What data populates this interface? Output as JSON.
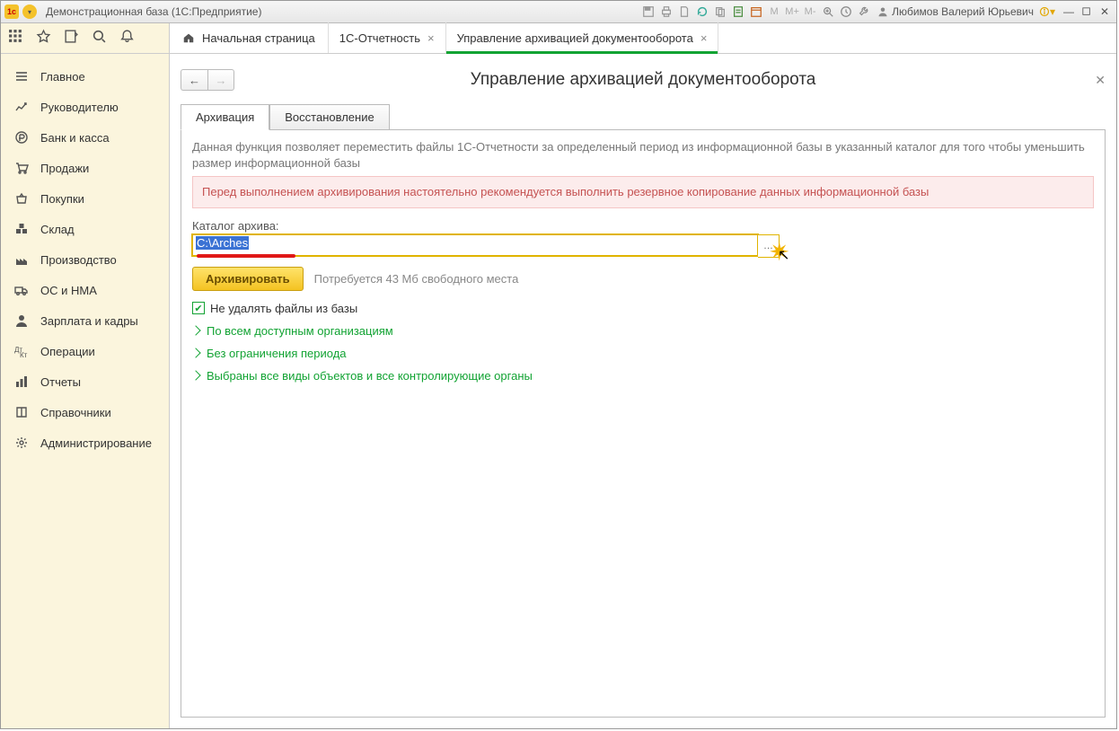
{
  "window_title": "Демонстрационная база  (1С:Предприятие)",
  "user_name": "Любимов Валерий Юрьевич",
  "m_buttons": [
    "M",
    "M+",
    "M-"
  ],
  "nav_items": [
    {
      "icon": "menu",
      "label": "Главное"
    },
    {
      "icon": "chart",
      "label": "Руководителю"
    },
    {
      "icon": "ruble",
      "label": "Банк и касса"
    },
    {
      "icon": "cart",
      "label": "Продажи"
    },
    {
      "icon": "basket",
      "label": "Покупки"
    },
    {
      "icon": "boxes",
      "label": "Склад"
    },
    {
      "icon": "factory",
      "label": "Производство"
    },
    {
      "icon": "truck",
      "label": "ОС и НМА"
    },
    {
      "icon": "person",
      "label": "Зарплата и кадры"
    },
    {
      "icon": "ops",
      "label": "Операции"
    },
    {
      "icon": "bars",
      "label": "Отчеты"
    },
    {
      "icon": "book",
      "label": "Справочники"
    },
    {
      "icon": "gear",
      "label": "Администрирование"
    }
  ],
  "tabs": {
    "home": "Начальная страница",
    "t1": "1С-Отчетность",
    "t2": "Управление архивацией документооборота"
  },
  "page_title": "Управление архивацией документооборота",
  "inner_tabs": {
    "t1": "Архивация",
    "t2": "Восстановление"
  },
  "desc": "Данная функция позволяет переместить файлы 1С-Отчетности за определенный период из информационной базы в указанный каталог для того чтобы уменьшить размер информационной базы",
  "warning": "Перед выполнением архивирования настоятельно рекомендуется выполнить резервное копирование данных информационной базы",
  "catalog_label": "Каталог архива:",
  "catalog_path": "C:\\Arches",
  "archive_btn": "Архивировать",
  "size_hint": "Потребуется 43 Мб свободного места",
  "checkbox_label": "Не удалять файлы из базы",
  "links": [
    "По всем доступным организациям",
    "Без ограничения периода",
    "Выбраны все виды объектов и все контролирующие органы"
  ]
}
